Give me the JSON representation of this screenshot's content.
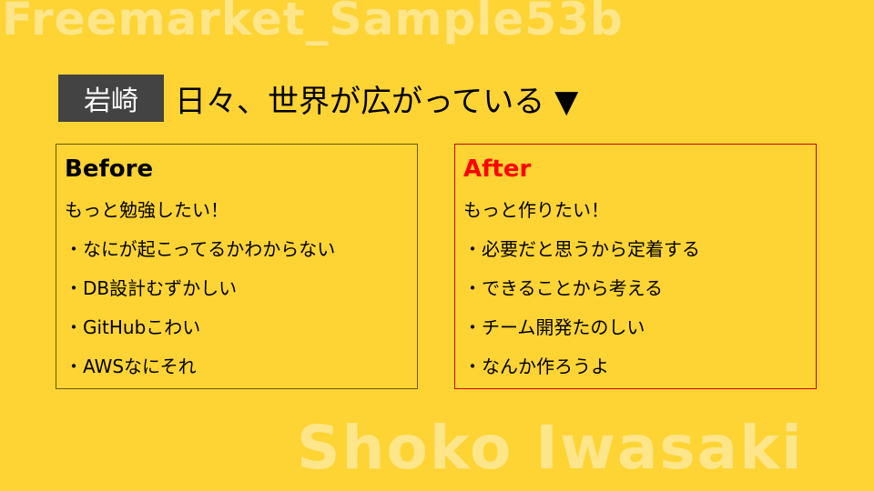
{
  "watermark": {
    "top": "Freemarket_Sample53b",
    "bottom": "Shoko Iwasaki"
  },
  "header": {
    "name": "岩崎",
    "headline": "日々、世界が広がっている ▼"
  },
  "before": {
    "title": "Before",
    "lines": [
      "もっと勉強したい！",
      "・なにが起こってるかわからない",
      "・DB設計むずかしい",
      "・GitHubこわい",
      "・AWSなにそれ"
    ]
  },
  "after": {
    "title": "After",
    "lines": [
      "もっと作りたい！",
      "・必要だと思うから定着する",
      "・できることから考える",
      "・チーム開発たのしい",
      "・なんか作ろうよ"
    ]
  },
  "colors": {
    "background": "#FDD434",
    "watermark": "#FDE58A",
    "badge": "#434343",
    "after_accent": "#ff0000"
  }
}
